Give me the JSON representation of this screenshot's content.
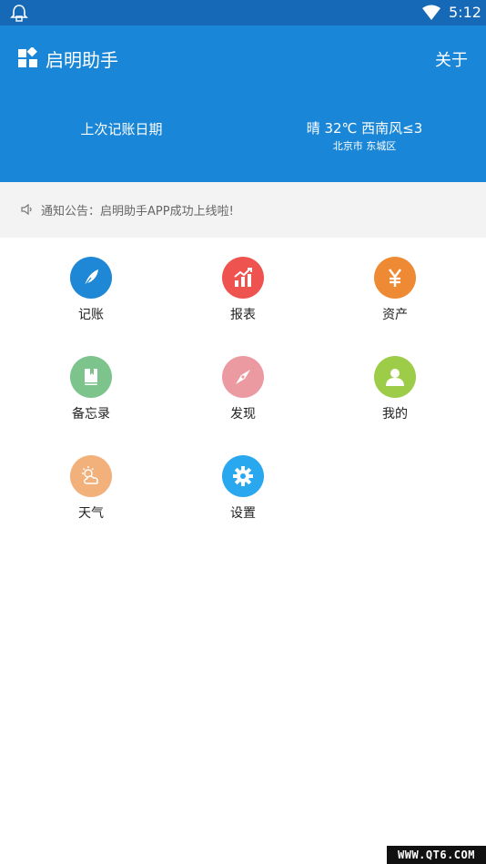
{
  "status_bar": {
    "time": "5:12",
    "icons": [
      "notification-icon",
      "wifi-icon"
    ]
  },
  "header": {
    "title": "启明助手",
    "about_label": "关于",
    "last_date_label": "上次记账日期",
    "weather": {
      "summary": "晴 32℃ 西南风≤3",
      "location": "北京市 东城区"
    }
  },
  "notice": {
    "text": "通知公告：启明助手APP成功上线啦!"
  },
  "grid": {
    "items": [
      {
        "label": "记账",
        "icon": "feather-icon",
        "color": "#1e88d6"
      },
      {
        "label": "报表",
        "icon": "chart-icon",
        "color": "#ef5350"
      },
      {
        "label": "资产",
        "icon": "yen-icon",
        "color": "#ef8a34"
      },
      {
        "label": "备忘录",
        "icon": "book-icon",
        "color": "#7cc48b"
      },
      {
        "label": "发现",
        "icon": "compass-icon",
        "color": "#ec9aa1"
      },
      {
        "label": "我的",
        "icon": "user-icon",
        "color": "#9ccc48"
      },
      {
        "label": "天气",
        "icon": "weather-icon",
        "color": "#f2b07a"
      },
      {
        "label": "设置",
        "icon": "gear-icon",
        "color": "#29a8f0"
      }
    ]
  },
  "watermark": "WWW.QT6.COM"
}
